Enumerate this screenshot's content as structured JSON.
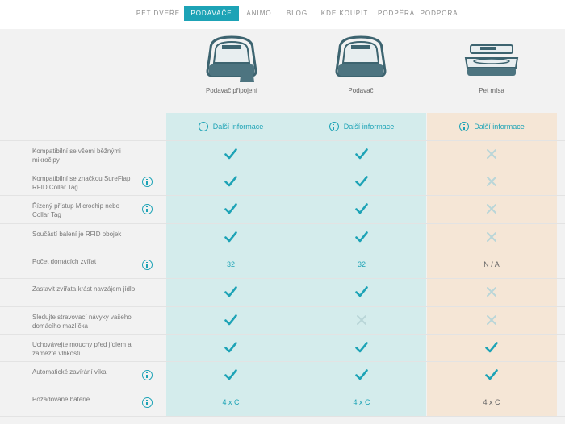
{
  "nav": {
    "items": [
      "PET DVEŘE",
      "PODAVAČE",
      "ANIMO",
      "BLOG",
      "KDE KOUPIT",
      "PODPĚRA, PODPORA"
    ],
    "active_index": 1
  },
  "products": [
    {
      "name": "Podavač připojení",
      "icon": "connect-feeder-with-cat-icon"
    },
    {
      "name": "Podavač",
      "icon": "microchip-feeder-icon"
    },
    {
      "name": "Pet mísa",
      "icon": "pet-bowl-icon"
    }
  ],
  "info_label": "Další informace",
  "colors": {
    "accent": "#1da3b6",
    "teal_column": "#d4ecec",
    "peach_column": "#f5e6d6",
    "cross": "#b9d6d8"
  },
  "rows": [
    {
      "label": "Kompatibilní se všemi běžnými mikročipy",
      "has_info": false,
      "cells": [
        "check",
        "check",
        "cross"
      ]
    },
    {
      "label": "Kompatibilní se značkou SureFlap RFID Collar Tag",
      "has_info": true,
      "cells": [
        "check",
        "check",
        "cross"
      ]
    },
    {
      "label": "Řízený přístup Microchip nebo Collar Tag",
      "has_info": true,
      "cells": [
        "check",
        "check",
        "cross"
      ]
    },
    {
      "label": "Součástí balení je RFID obojek",
      "has_info": false,
      "cells": [
        "check",
        "check",
        "cross"
      ]
    },
    {
      "label": "Počet domácích zvířat",
      "has_info": true,
      "cells": [
        "32",
        "32",
        "N / A"
      ]
    },
    {
      "label": "Zastavit zvířata krást navzájem jídlo",
      "has_info": false,
      "cells": [
        "check",
        "check",
        "cross"
      ]
    },
    {
      "label": "Sledujte stravovací návyky vašeho domácího mazlíčka",
      "has_info": false,
      "cells": [
        "check",
        "cross",
        "cross"
      ]
    },
    {
      "label": "Uchovávejte mouchy před jídlem a zamezte vlhkosti",
      "has_info": false,
      "cells": [
        "check",
        "check",
        "check"
      ]
    },
    {
      "label": "Automatické zavírání víka",
      "has_info": true,
      "cells": [
        "check",
        "check",
        "check"
      ]
    },
    {
      "label": "Požadované baterie",
      "has_info": true,
      "cells": [
        "4 x C",
        "4 x C",
        "4 x C"
      ]
    }
  ]
}
